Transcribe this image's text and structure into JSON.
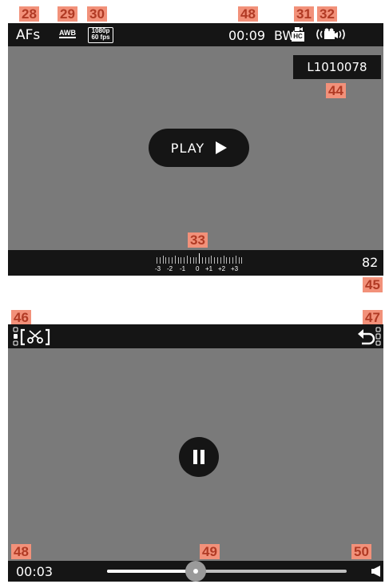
{
  "callouts": {
    "c28": "28",
    "c29": "29",
    "c30": "30",
    "c48a": "48",
    "c31": "31",
    "c32": "32",
    "c44": "44",
    "c33": "33",
    "c45": "45",
    "c46": "46",
    "c47": "47",
    "c48b": "48",
    "c49": "49",
    "c50": "50"
  },
  "top_screen": {
    "af_mode": "AFs",
    "white_balance": "AWB",
    "resolution": "1080p",
    "frame_rate": "60 fps",
    "elapsed_time": "00:09",
    "film_style": "BW",
    "film_style_badge": "HC",
    "file_name": "L1010078",
    "play_label": "PLAY",
    "exposure_scale": [
      "-3",
      "-2",
      "-1",
      "0",
      "+1",
      "+2",
      "+3"
    ],
    "frame_count": "82"
  },
  "bottom_screen": {
    "current_time": "00:03",
    "progress": 0.37
  },
  "colors": {
    "callout_bg": "#f2917a",
    "callout_text": "#b03a24",
    "screen_bg": "#7a7a7a",
    "bar_bg": "#151515"
  }
}
